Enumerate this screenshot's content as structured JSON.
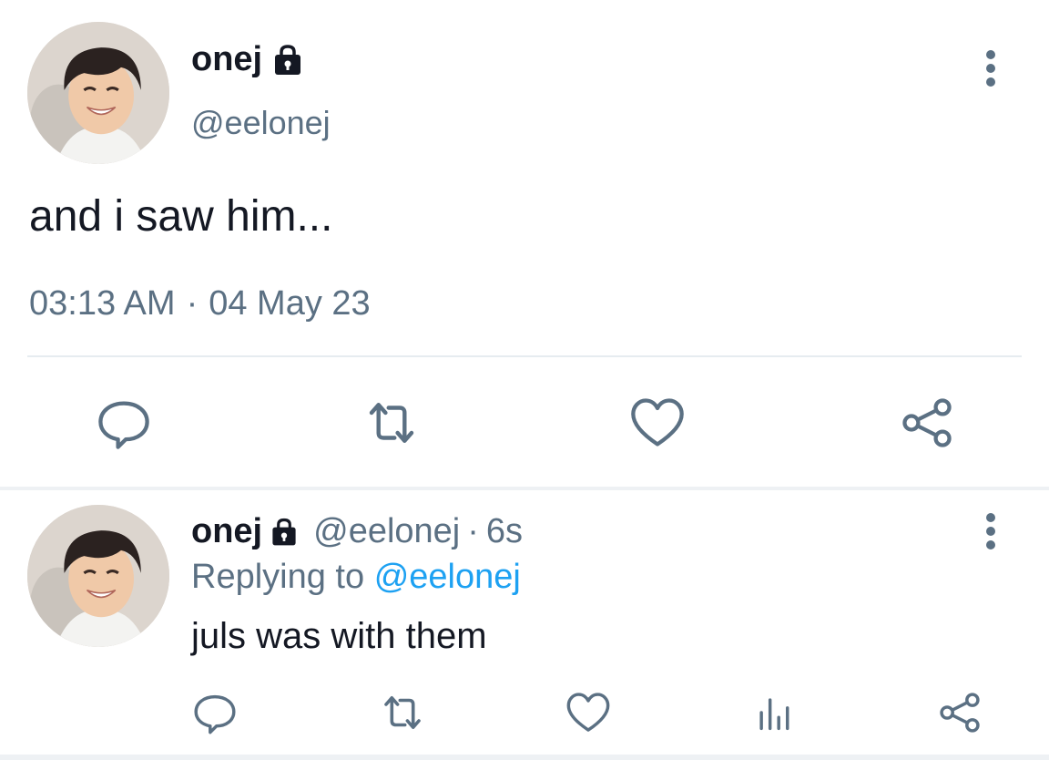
{
  "tweet": {
    "display_name": "onej",
    "handle": "@eelonej",
    "text": "and i saw him...",
    "time": "03:13 AM",
    "separator": "·",
    "date": "04 May 23",
    "icons": [
      "lock-icon",
      "more-icon",
      "reply-icon",
      "retweet-icon",
      "like-icon",
      "share-icon"
    ]
  },
  "reply": {
    "display_name": "onej",
    "handle": "@eelonej",
    "separator": "·",
    "age": "6s",
    "replying_prefix": "Replying to",
    "replying_to": "@eelonej",
    "text": "juls was with them",
    "icons": [
      "lock-icon",
      "more-icon",
      "reply-icon",
      "retweet-icon",
      "like-icon",
      "analytics-icon",
      "share-icon"
    ]
  },
  "colors": {
    "text_primary": "#141823",
    "text_secondary": "#5b7083",
    "mention": "#1da1f2",
    "divider": "#e6ecf0"
  }
}
